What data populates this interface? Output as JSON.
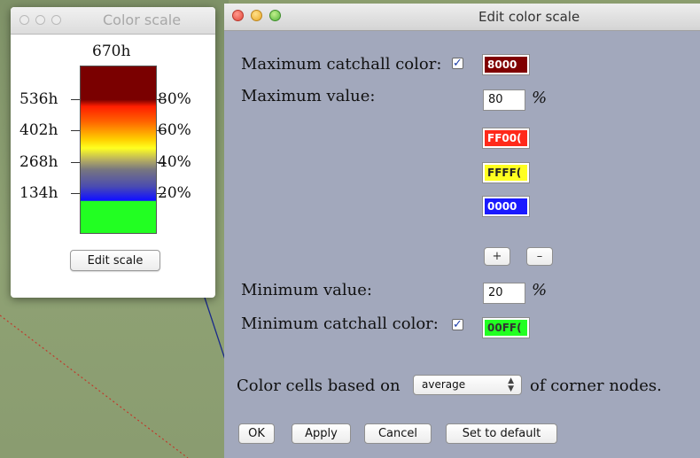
{
  "color_scale_window": {
    "title": "Color scale",
    "top_label": "670h",
    "left_ticks": [
      "536h",
      "402h",
      "268h",
      "134h"
    ],
    "right_ticks": [
      "80%",
      "60%",
      "40%",
      "20%"
    ],
    "edit_button": "Edit scale"
  },
  "dialog": {
    "title": "Edit color scale",
    "max_catchall_label": "Maximum catchall color:",
    "max_catchall_checked": true,
    "max_catchall_color": "8000",
    "max_catchall_bg": "#800000",
    "max_value_label": "Maximum value:",
    "max_value": "80",
    "percent": "%",
    "stops": [
      {
        "text": "FF00(",
        "bg": "#ff2a1a",
        "fg": "#ffffff"
      },
      {
        "text": "FFFF(",
        "bg": "#ffff20",
        "fg": "#222222"
      },
      {
        "text": "0000",
        "bg": "#1a1aff",
        "fg": "#ffffff"
      }
    ],
    "add_button": "+",
    "remove_button": "–",
    "min_value_label": "Minimum value:",
    "min_value": "20",
    "min_catchall_label": "Minimum catchall color:",
    "min_catchall_checked": true,
    "min_catchall_color": "00FF(",
    "min_catchall_bg": "#22ff22",
    "color_cells_prefix": "Color cells based on",
    "color_cells_select": "average",
    "color_cells_suffix": "of corner nodes.",
    "ok": "OK",
    "apply": "Apply",
    "cancel": "Cancel",
    "default": "Set to default"
  }
}
